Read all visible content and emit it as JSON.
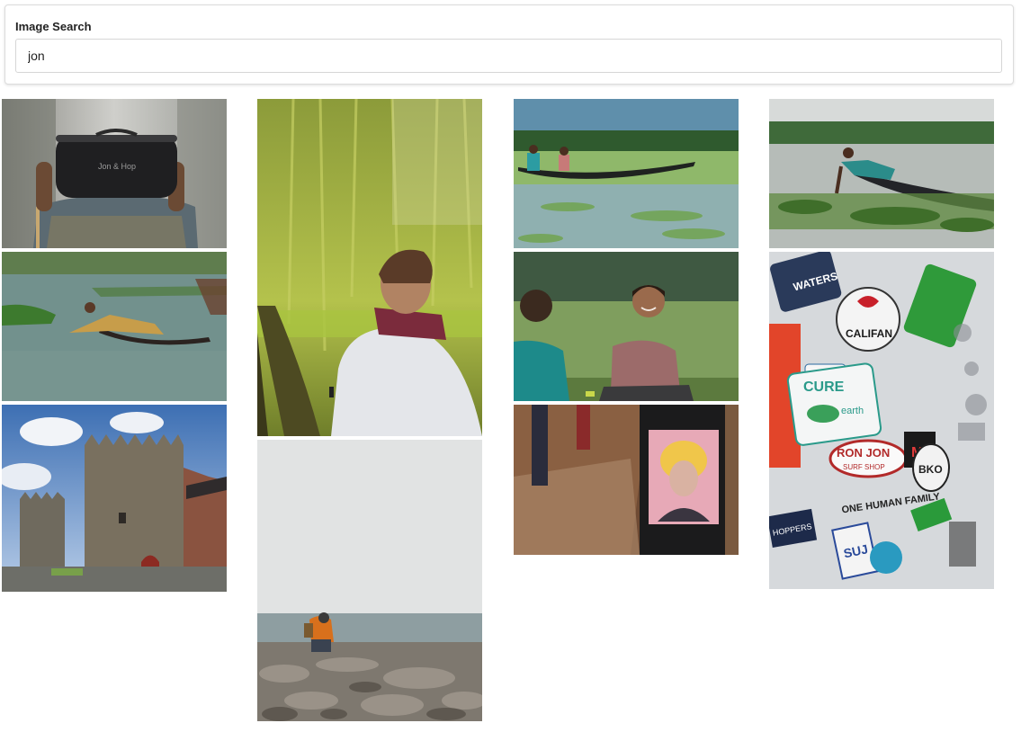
{
  "search": {
    "label": "Image Search",
    "value": "jon"
  },
  "results": [
    {
      "name": "photo-hands-holding-jon-hop-bag",
      "caption": "Jon & Hop"
    },
    {
      "name": "photo-man-on-wooden-boat-lake"
    },
    {
      "name": "photo-stone-castle-tower"
    },
    {
      "name": "photo-man-looking-at-willow-tree"
    },
    {
      "name": "photo-person-crouching-rocky-shore"
    },
    {
      "name": "photo-two-people-in-canoe"
    },
    {
      "name": "photo-boys-sitting-by-field"
    },
    {
      "name": "photo-pop-art-portrait-poster"
    },
    {
      "name": "photo-man-pushing-boat"
    },
    {
      "name": "photo-sticker-covered-wall",
      "stickers": [
        "WATERS",
        "CALIFAN",
        "CURE",
        "earth",
        "RON JON",
        "SURF SHOP",
        "BKO",
        "ONE HUMAN FAMILY",
        "HOPPERS",
        "SUJ"
      ]
    }
  ]
}
